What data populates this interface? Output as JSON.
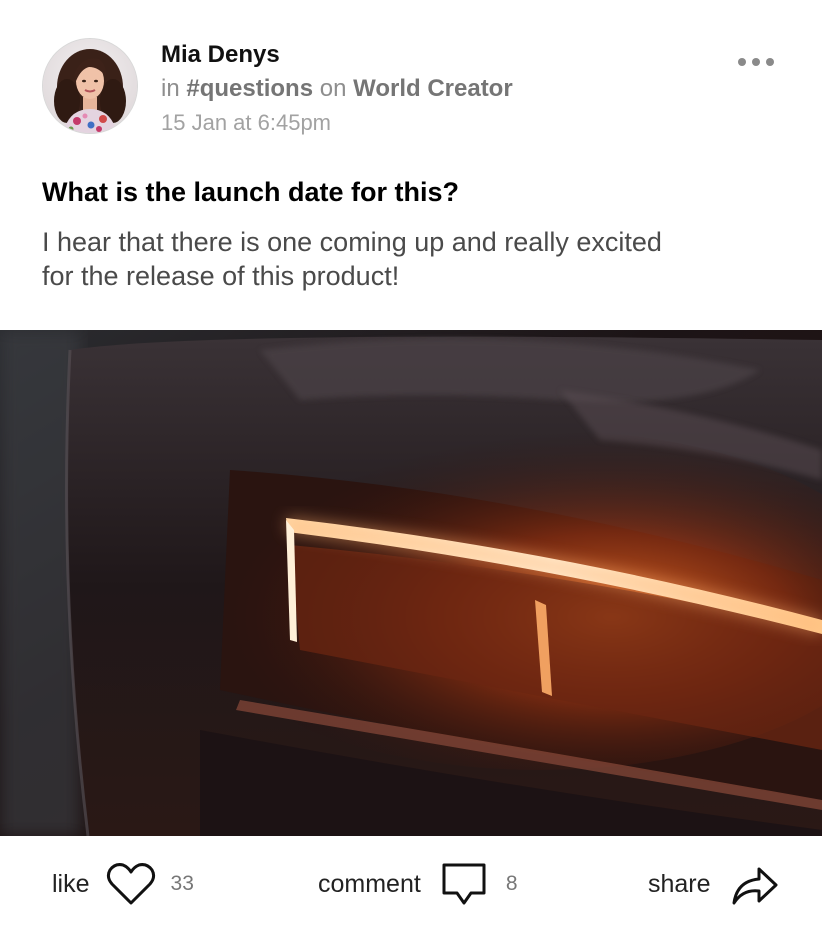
{
  "post": {
    "author": {
      "name": "Mia Denys",
      "avatar_icon": "avatar-photo"
    },
    "meta": {
      "in_word": "in",
      "channel": "#questions",
      "on_word": "on",
      "community": "World Creator"
    },
    "timestamp": "15 Jan at 6:45pm",
    "more_icon": "more-horizontal-icon",
    "title": "What is the launch date for this?",
    "body": "I hear that there is one coming up and really excited for the release of this product!",
    "image_icon": "car-headlight-photo"
  },
  "actions": {
    "like": {
      "label": "like",
      "icon": "heart-icon",
      "count": "33"
    },
    "comment": {
      "label": "comment",
      "icon": "comment-bubble-icon",
      "count": "8"
    },
    "share": {
      "label": "share",
      "icon": "share-arrow-icon"
    }
  },
  "colors": {
    "text_primary": "#111111",
    "text_muted": "#8e8e8e",
    "headlight_glow": "#ff6a1a"
  }
}
